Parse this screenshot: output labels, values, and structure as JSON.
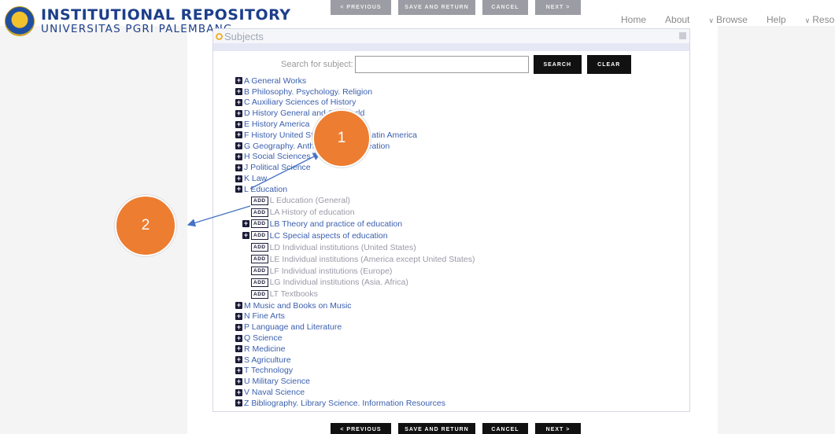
{
  "header": {
    "logo_title": "INSTITUTIONAL REPOSITORY",
    "logo_subtitle": "UNIVERSITAS PGRI PALEMBANG",
    "nav": [
      {
        "label": "Home",
        "dropdown": false
      },
      {
        "label": "About",
        "dropdown": false
      },
      {
        "label": "Browse",
        "dropdown": true
      },
      {
        "label": "Help",
        "dropdown": false
      },
      {
        "label": "Resour",
        "dropdown": true
      }
    ]
  },
  "buttons": {
    "previous": "< PREVIOUS",
    "save_return": "SAVE AND RETURN",
    "cancel": "CANCEL",
    "next": "NEXT >"
  },
  "panel": {
    "title": "Subjects",
    "search_label": "Search for subject:",
    "search_value": "",
    "search_button": "SEARCH",
    "clear_button": "CLEAR"
  },
  "add_label": "ADD",
  "subjects": [
    {
      "label": "A General Works"
    },
    {
      "label": "B Philosophy. Psychology. Religion"
    },
    {
      "label": "C Auxiliary Sciences of History"
    },
    {
      "label": "D History General and Old World"
    },
    {
      "label": "E History America"
    },
    {
      "label": "F History United States, Canada, Latin America"
    },
    {
      "label": "G Geography. Anthropology. Recreation"
    },
    {
      "label": "H Social Sciences"
    },
    {
      "label": "J Political Science"
    },
    {
      "label": "K Law"
    },
    {
      "label": "L Education"
    }
  ],
  "education_children": [
    {
      "label": "L Education (General)",
      "expandable": false,
      "link": false
    },
    {
      "label": "LA History of education",
      "expandable": false,
      "link": false
    },
    {
      "label": "LB Theory and practice of education",
      "expandable": true,
      "link": true
    },
    {
      "label": "LC Special aspects of education",
      "expandable": true,
      "link": true
    },
    {
      "label": "LD Individual institutions (United States)",
      "expandable": false,
      "link": false
    },
    {
      "label": "LE Individual institutions (America except United States)",
      "expandable": false,
      "link": false
    },
    {
      "label": "LF Individual institutions (Europe)",
      "expandable": false,
      "link": false
    },
    {
      "label": "LG Individual institutions (Asia. Africa)",
      "expandable": false,
      "link": false
    },
    {
      "label": "LT Textbooks",
      "expandable": false,
      "link": false
    }
  ],
  "subjects_after": [
    {
      "label": "M Music and Books on Music"
    },
    {
      "label": "N Fine Arts"
    },
    {
      "label": "P Language and Literature"
    },
    {
      "label": "Q Science"
    },
    {
      "label": "R Medicine"
    },
    {
      "label": "S Agriculture"
    },
    {
      "label": "T Technology"
    },
    {
      "label": "U Military Science"
    },
    {
      "label": "V Naval Science"
    },
    {
      "label": "Z Bibliography. Library Science. Information Resources"
    }
  ],
  "callouts": {
    "one": "1",
    "two": "2"
  },
  "colors": {
    "accent": "#ed7d31",
    "link": "#3a5fae",
    "brand": "#1d3f8a"
  }
}
